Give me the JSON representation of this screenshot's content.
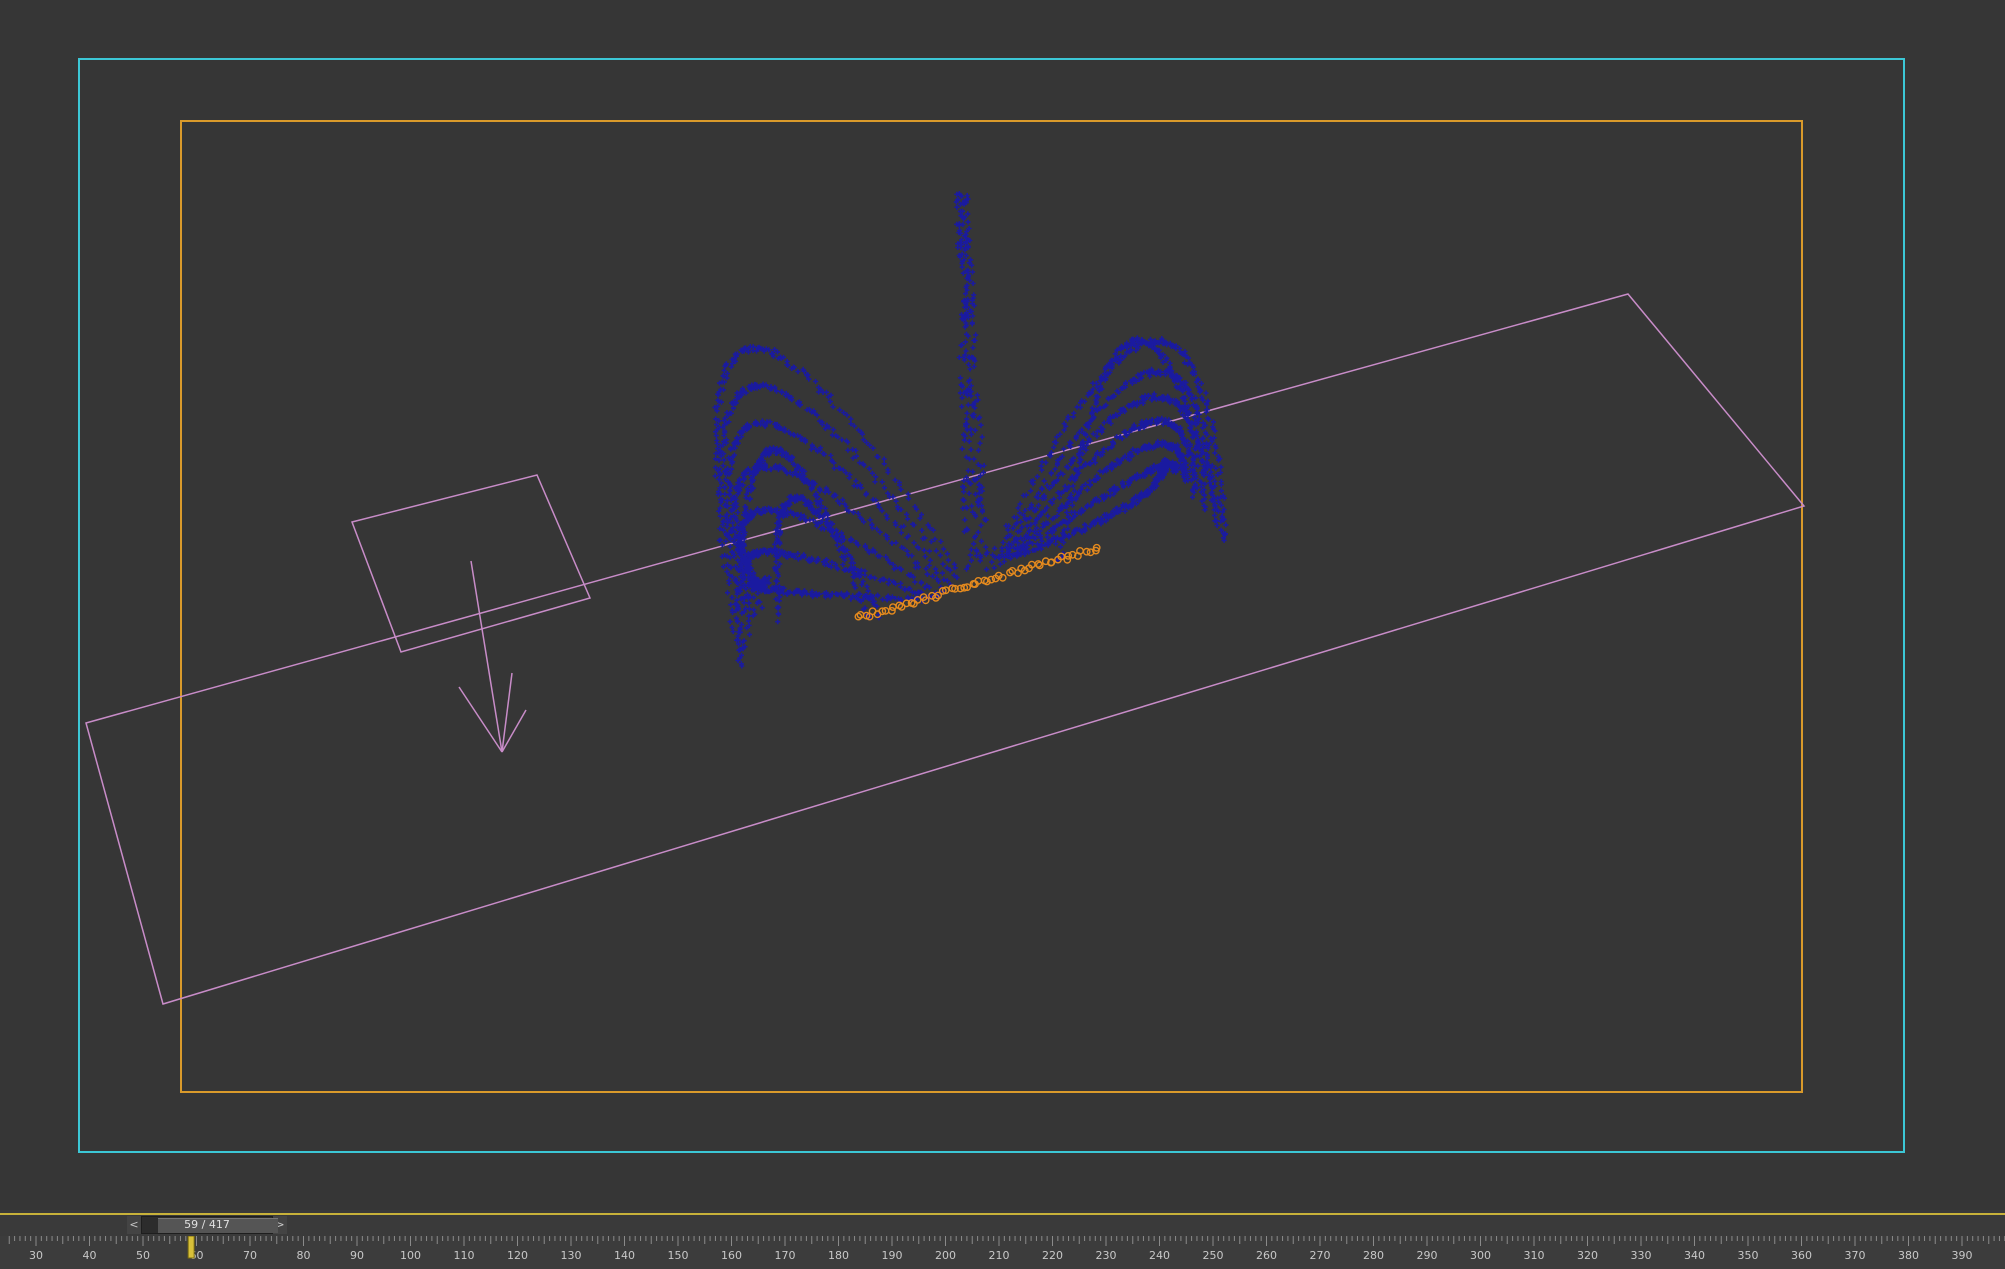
{
  "viewport": {
    "colors": {
      "background": "#363636",
      "safe_frame_outer": "#3cc7d6",
      "safe_frame_inner": "#d99a2b",
      "helper_gizmo": "#c88cc8",
      "particles": "#1a1aa0",
      "emitter": "#e58a1e"
    },
    "icons": [
      "gravity-arrow-icon"
    ]
  },
  "timeline": {
    "slider_label": "59 / 417",
    "prev_label": "<",
    "next_label": ">",
    "current_frame": 59,
    "total_frames": 417,
    "ruler_labels": [
      "30",
      "40",
      "50",
      "60",
      "70",
      "80",
      "90",
      "100",
      "110",
      "120",
      "130",
      "140",
      "150",
      "160",
      "170",
      "180",
      "190",
      "200",
      "210",
      "220",
      "230",
      "240",
      "250",
      "260",
      "270",
      "280",
      "290",
      "300",
      "310",
      "320",
      "330",
      "340",
      "350",
      "360",
      "370",
      "380",
      "390"
    ],
    "colors": {
      "ruler_text": "#c8c8c8",
      "playhead": "#d8c03a"
    }
  }
}
